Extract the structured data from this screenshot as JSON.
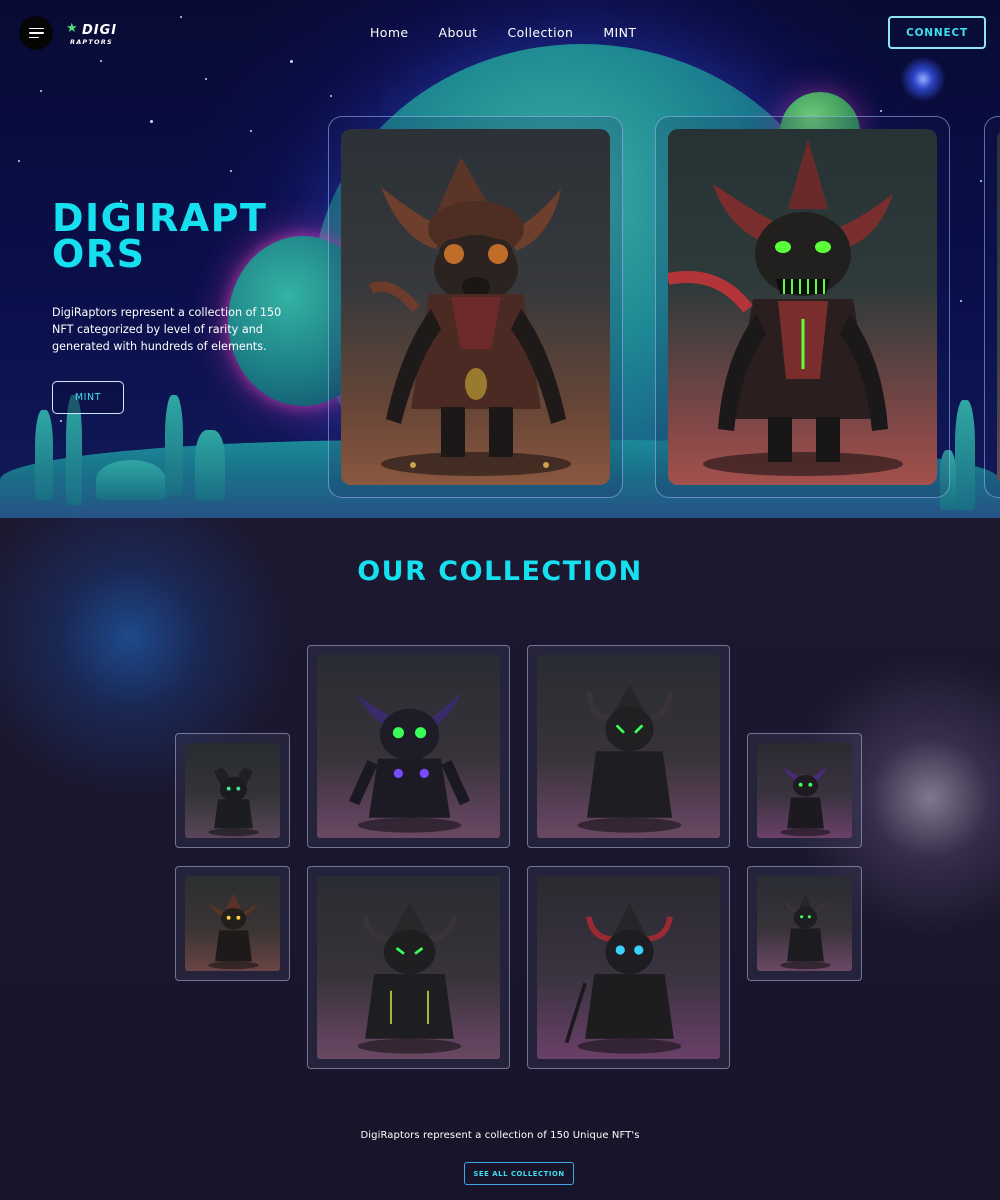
{
  "header": {
    "logo_line1": "DIGI",
    "logo_line2": "RAPTORS",
    "nav": [
      {
        "label": "Home"
      },
      {
        "label": "About"
      },
      {
        "label": "Collection"
      },
      {
        "label": "MINT"
      }
    ],
    "connect_label": "CONNECT"
  },
  "hero": {
    "title": "DIGIRAPTORS",
    "description": "DigiRaptors represent a collection of 150 NFT categorized by level of rarity and generated with hundreds of elements.",
    "mint_label": "MINT"
  },
  "collection": {
    "title": "OUR COLLECTION",
    "description": "DigiRaptors represent a collection of 150 Unique NFT's",
    "see_all_label": "SEE ALL COLLECTION"
  },
  "colors": {
    "accent": "#16dff0",
    "hero_bg": "#0a0f4a",
    "collection_bg": "#18142a"
  }
}
